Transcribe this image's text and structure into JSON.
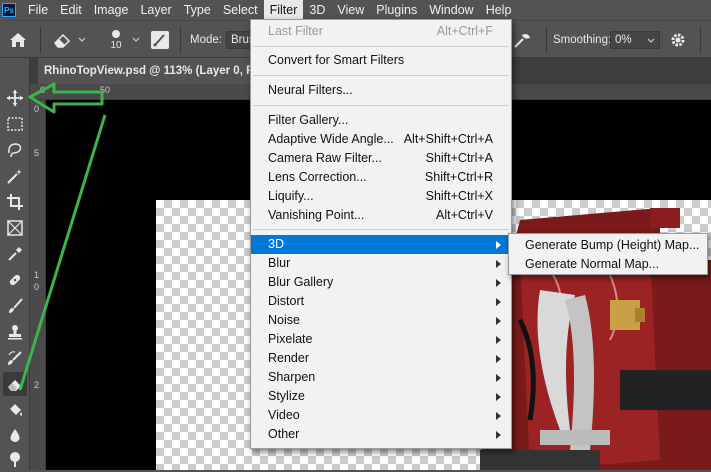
{
  "app": {
    "logo_text": "Ps"
  },
  "menubar": [
    {
      "label": "File"
    },
    {
      "label": "Edit"
    },
    {
      "label": "Image"
    },
    {
      "label": "Layer"
    },
    {
      "label": "Type"
    },
    {
      "label": "Select"
    },
    {
      "label": "Filter"
    },
    {
      "label": "3D"
    },
    {
      "label": "View"
    },
    {
      "label": "Plugins"
    },
    {
      "label": "Window"
    },
    {
      "label": "Help"
    }
  ],
  "options": {
    "brush_size": "10",
    "mode_label": "Mode:",
    "mode_value": "Brus",
    "smoothing_label": "Smoothing:",
    "smoothing_value": "0%"
  },
  "document": {
    "tab_title": "RhinoTopView.psd @ 113% (Layer 0, RG"
  },
  "ruler": {
    "top_labels": [
      "50",
      "0"
    ],
    "left_labels": [
      "0",
      "5",
      "1",
      "0",
      "2"
    ]
  },
  "filter_menu": {
    "last_filter": {
      "label": "Last Filter",
      "shortcut": "Alt+Ctrl+F"
    },
    "convert": {
      "label": "Convert for Smart Filters"
    },
    "neural": {
      "label": "Neural Filters..."
    },
    "group1": [
      {
        "label": "Filter Gallery...",
        "shortcut": ""
      },
      {
        "label": "Adaptive Wide Angle...",
        "shortcut": "Alt+Shift+Ctrl+A"
      },
      {
        "label": "Camera Raw Filter...",
        "shortcut": "Shift+Ctrl+A"
      },
      {
        "label": "Lens Correction...",
        "shortcut": "Shift+Ctrl+R"
      },
      {
        "label": "Liquify...",
        "shortcut": "Shift+Ctrl+X"
      },
      {
        "label": "Vanishing Point...",
        "shortcut": "Alt+Ctrl+V"
      }
    ],
    "submenus": [
      {
        "label": "3D"
      },
      {
        "label": "Blur"
      },
      {
        "label": "Blur Gallery"
      },
      {
        "label": "Distort"
      },
      {
        "label": "Noise"
      },
      {
        "label": "Pixelate"
      },
      {
        "label": "Render"
      },
      {
        "label": "Sharpen"
      },
      {
        "label": "Stylize"
      },
      {
        "label": "Video"
      },
      {
        "label": "Other"
      }
    ]
  },
  "submenu_3d": [
    {
      "label": "Generate Bump (Height) Map..."
    },
    {
      "label": "Generate Normal Map..."
    }
  ],
  "colors": {
    "highlight": "#0078d7",
    "annotation": "#3cb44b"
  }
}
